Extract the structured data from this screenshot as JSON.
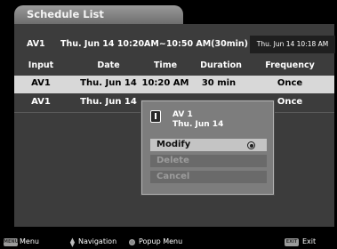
{
  "screen": {
    "title": "Schedule List"
  },
  "current": {
    "input": "AV1",
    "schedule": "Thu. Jun 14  10:20AM~10:50 AM(30min)",
    "clock": "Thu. Jun 14 10:18 AM"
  },
  "table": {
    "headers": [
      "Input",
      "Date",
      "Time",
      "Duration",
      "Frequency"
    ],
    "rows": [
      {
        "input": "AV1",
        "date": "Thu. Jun 14",
        "time": "10:20 AM",
        "duration": "30 min",
        "frequency": "Once"
      },
      {
        "input": "AV1",
        "date": "Thu. Jun 14",
        "frequency": "Once"
      }
    ]
  },
  "popup": {
    "title_line1": "AV 1",
    "title_line2": "Thu. Jun 14",
    "items": [
      "Modify",
      "Delete",
      "Cancel"
    ]
  },
  "footer": {
    "menu_key": "MENU",
    "menu_label": "Menu",
    "nav_label": "Navigation",
    "popup_label": "Popup Menu",
    "exit_key": "EXIT",
    "exit_label": "Exit"
  },
  "colors": {
    "background": "#000000",
    "panel": "#3c3c3c",
    "selected_row": "#d8d8d8",
    "popup": "#7d7d7d",
    "active_item": "#c4c4c4"
  },
  "icons": {
    "popup": "input-source-icon",
    "selected": "radio-selected-icon",
    "navigation": "up-down-arrows-icon",
    "ok": "ok-button-icon"
  }
}
